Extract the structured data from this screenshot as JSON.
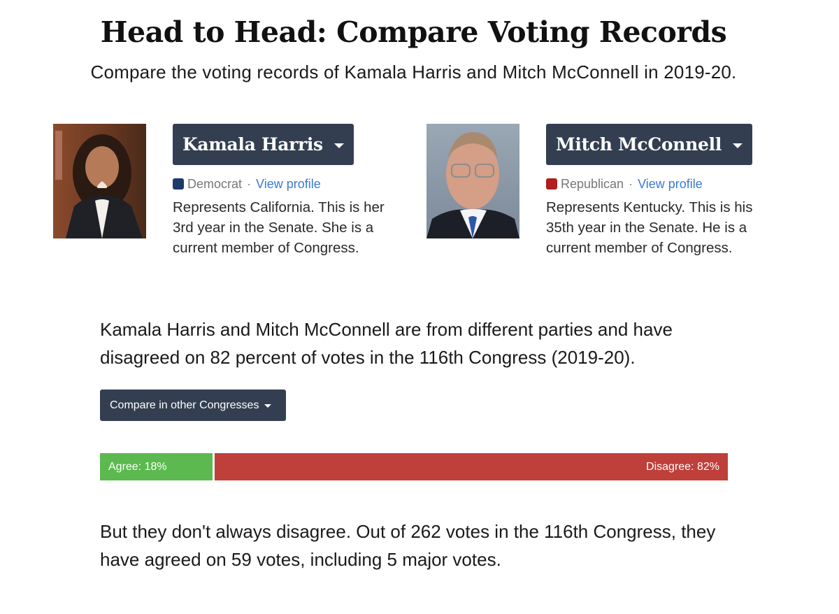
{
  "header": {
    "title": "Head to Head: Compare Voting Records",
    "subtitle": "Compare the voting records of Kamala Harris and Mitch McConnell in 2019-20."
  },
  "members": [
    {
      "name": "Kamala Harris",
      "party": "Democrat",
      "party_color": "#1b3a6b",
      "separator": "·",
      "profile_link": "View profile",
      "bio": "Represents California. This is her 3rd year in the Senate. She is a current member of Congress.",
      "photo_icon": "portrait-photo"
    },
    {
      "name": "Mitch McConnell",
      "party": "Republican",
      "party_color": "#b01e1e",
      "separator": "·",
      "profile_link": "View profile",
      "bio": "Represents Kentucky. This is his 35th year in the Senate. He is a current member of Congress.",
      "photo_icon": "portrait-photo"
    }
  ],
  "summary": "Kamala Harris and Mitch McConnell are from different parties and have disagreed on 82 percent of votes in the 116th Congress (2019-20).",
  "congress_selector": {
    "label": "Compare in other Congresses"
  },
  "agreement_bar": {
    "agree": {
      "label": "Agree: 18%",
      "percent": 18,
      "color": "#5cb94f"
    },
    "disagree": {
      "label": "Disagree: 82%",
      "percent": 82,
      "color": "#bf3f3a"
    }
  },
  "closing": "But they don't always disagree. Out of 262 votes in the 116th Congress, they have agreed on 59 votes, including 5 major votes."
}
